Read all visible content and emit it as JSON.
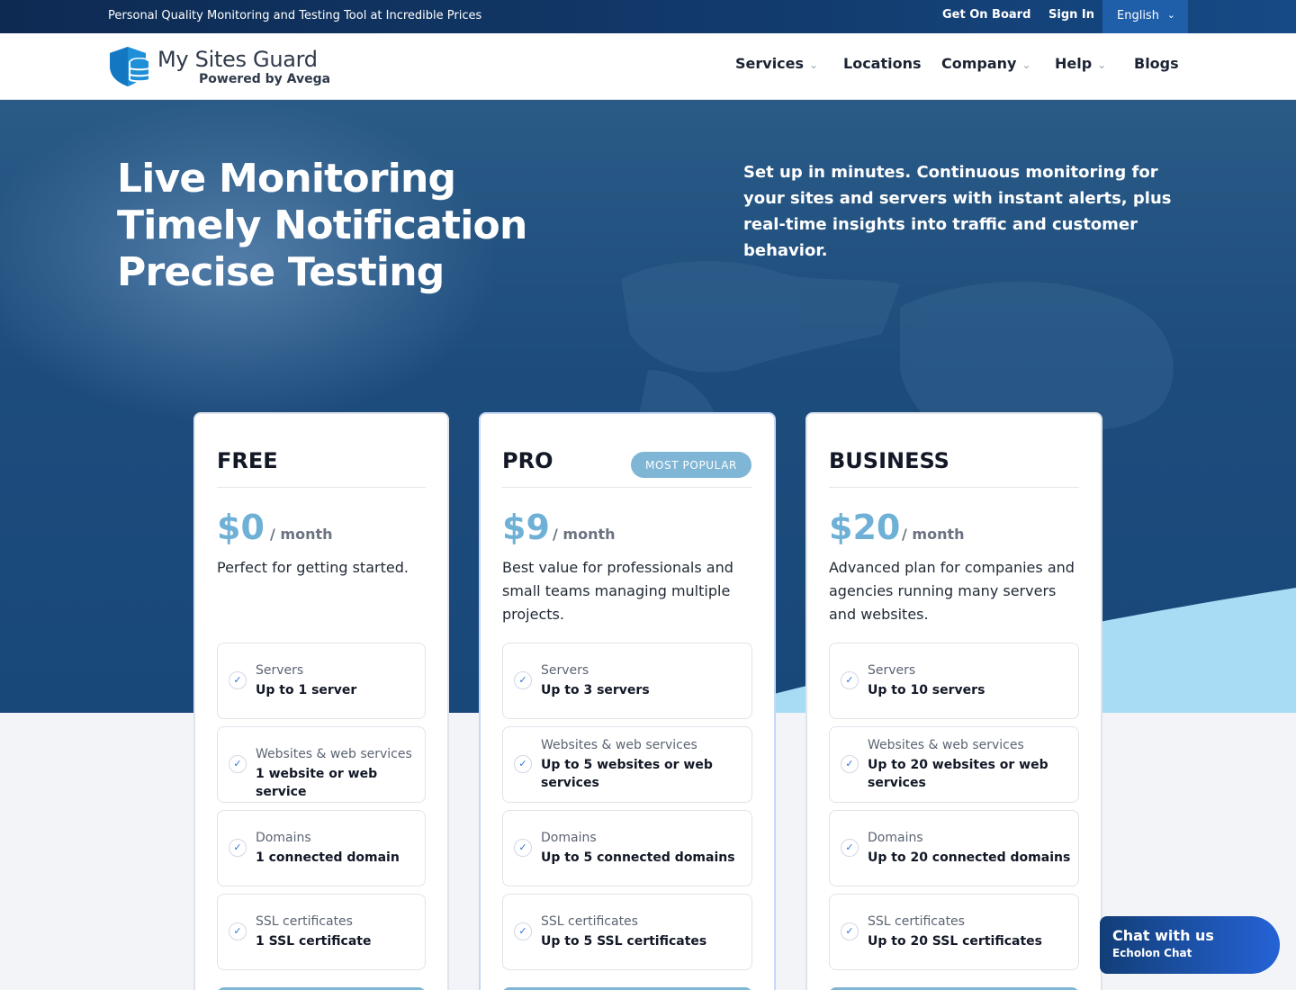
{
  "topbar": {
    "tagline": "Personal Quality Monitoring and Testing Tool at Incredible Prices",
    "get_on_board": "Get On Board",
    "sign_in": "Sign In",
    "language": "English"
  },
  "header": {
    "brand_name": "My Sites Guard",
    "brand_sub": "Powered by Avega",
    "nav": [
      "Services",
      "Locations",
      "Company",
      "Help",
      "Blogs"
    ]
  },
  "hero": {
    "headline_1": "Live Monitoring",
    "headline_2": "Timely Notification",
    "headline_3": "Precise Testing",
    "subtext": "Set up in minutes. Continuous monitoring for your sites and servers with instant alerts, plus real-time insights into traffic and customer behavior."
  },
  "plans": [
    {
      "name": "FREE",
      "price": "$0",
      "period": "/ month",
      "description": "Perfect for getting started.",
      "features": [
        {
          "label": "Servers",
          "value": "Up to 1 server"
        },
        {
          "label": "Websites & web services",
          "value": "1 website or web service"
        },
        {
          "label": "Domains",
          "value": "1 connected domain"
        },
        {
          "label": "SSL certificates",
          "value": "1 SSL certificate"
        }
      ]
    },
    {
      "name": "PRO",
      "badge": "MOST POPULAR",
      "price": "$9",
      "period": "/ month",
      "description": "Best value for professionals and small teams managing multiple projects.",
      "features": [
        {
          "label": "Servers",
          "value": "Up to 3 servers"
        },
        {
          "label": "Websites & web services",
          "value": "Up to 5 websites or web services"
        },
        {
          "label": "Domains",
          "value": "Up to 5 connected domains"
        },
        {
          "label": "SSL certificates",
          "value": "Up to 5 SSL certificates"
        }
      ]
    },
    {
      "name": "BUSINESS",
      "price": "$20",
      "period": "/ month",
      "description": "Advanced plan for companies and agencies running many servers and websites.",
      "features": [
        {
          "label": "Servers",
          "value": "Up to 10 servers"
        },
        {
          "label": "Websites & web services",
          "value": "Up to 20 websites or web services"
        },
        {
          "label": "Domains",
          "value": "Up to 20 connected domains"
        },
        {
          "label": "SSL certificates",
          "value": "Up to 20 SSL certificates"
        }
      ]
    }
  ],
  "chat": {
    "title": "Chat with us",
    "subtitle": "Echolon Chat"
  },
  "colors": {
    "accent": "#6fb0d6",
    "topbar": "#123b6d",
    "hero": "#1d4c7c",
    "chat": "#2563d6"
  }
}
